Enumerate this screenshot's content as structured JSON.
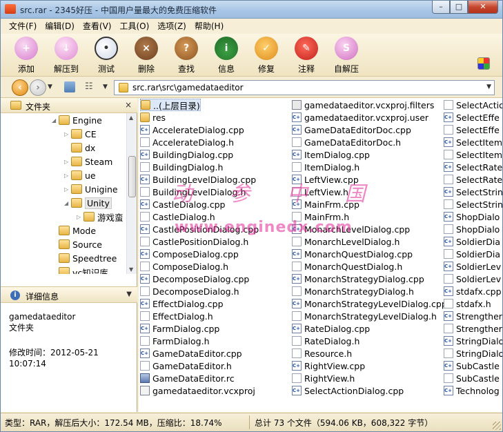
{
  "window": {
    "title": "src.rar - 2345好压 - 中国用户量最大的免费压缩软件",
    "controls": [
      "–",
      "□",
      "✕"
    ]
  },
  "menu": [
    "文件(F)",
    "编辑(D)",
    "查看(V)",
    "工具(O)",
    "选项(Z)",
    "帮助(H)"
  ],
  "toolbar": [
    {
      "label": "添加",
      "icon": "add-icon",
      "glyph": "+"
    },
    {
      "label": "解压到",
      "icon": "extract-icon",
      "glyph": "↓"
    },
    {
      "label": "测试",
      "icon": "test-icon",
      "glyph": "•"
    },
    {
      "label": "删除",
      "icon": "delete-icon",
      "glyph": "×"
    },
    {
      "label": "查找",
      "icon": "find-icon",
      "glyph": "?"
    },
    {
      "label": "信息",
      "icon": "info-icon",
      "glyph": "i"
    },
    {
      "label": "修复",
      "icon": "repair-icon",
      "glyph": "✓"
    },
    {
      "label": "注释",
      "icon": "comment-icon",
      "glyph": "✎"
    },
    {
      "label": "自解压",
      "icon": "sfx-icon",
      "glyph": "S"
    }
  ],
  "address": {
    "path": "src.rar\\src\\gamedataeditor"
  },
  "folders_panel": {
    "title": "文件夹",
    "close": "×",
    "tree": [
      {
        "label": "Engine",
        "depth": 0,
        "expander": "◢"
      },
      {
        "label": "CE",
        "depth": 1,
        "expander": "▷"
      },
      {
        "label": "dx",
        "depth": 1,
        "expander": ""
      },
      {
        "label": "Steam",
        "depth": 1,
        "expander": "▷"
      },
      {
        "label": "ue",
        "depth": 1,
        "expander": "▷"
      },
      {
        "label": "Unigine",
        "depth": 1,
        "expander": "▷"
      },
      {
        "label": "Unity",
        "depth": 1,
        "expander": "◢",
        "selected": true
      },
      {
        "label": "游戏蛮",
        "depth": 2,
        "expander": "▷"
      },
      {
        "label": "Mode",
        "depth": 0,
        "expander": ""
      },
      {
        "label": "Source",
        "depth": 0,
        "expander": ""
      },
      {
        "label": "Speedtree",
        "depth": 0,
        "expander": ""
      },
      {
        "label": "vc知识库",
        "depth": 0,
        "expander": ""
      }
    ]
  },
  "details_panel": {
    "title": "详细信息",
    "name": "gamedataeditor",
    "type": "文件夹",
    "modified": "修改时间：2012-05-21 10:07:14"
  },
  "files": {
    "col1": [
      {
        "name": "..(上层目录)",
        "type": "up",
        "selected": true
      },
      {
        "name": "res",
        "type": "folder"
      },
      {
        "name": "AccelerateDialog.cpp",
        "type": "cpp"
      },
      {
        "name": "AccelerateDialog.h",
        "type": "h"
      },
      {
        "name": "BuildingDialog.cpp",
        "type": "cpp"
      },
      {
        "name": "BuildingDialog.h",
        "type": "h"
      },
      {
        "name": "BuildingLevelDialog.cpp",
        "type": "cpp"
      },
      {
        "name": "BuildingLevelDialog.h",
        "type": "h"
      },
      {
        "name": "CastleDialog.cpp",
        "type": "cpp"
      },
      {
        "name": "CastleDialog.h",
        "type": "h"
      },
      {
        "name": "CastlePositionDialog.cpp",
        "type": "cpp"
      },
      {
        "name": "CastlePositionDialog.h",
        "type": "h"
      },
      {
        "name": "ComposeDialog.cpp",
        "type": "cpp"
      },
      {
        "name": "ComposeDialog.h",
        "type": "h"
      },
      {
        "name": "DecomposeDialog.cpp",
        "type": "cpp"
      },
      {
        "name": "DecomposeDialog.h",
        "type": "h"
      },
      {
        "name": "EffectDialog.cpp",
        "type": "cpp"
      },
      {
        "name": "EffectDialog.h",
        "type": "h"
      },
      {
        "name": "FarmDialog.cpp",
        "type": "cpp"
      },
      {
        "name": "FarmDialog.h",
        "type": "h"
      },
      {
        "name": "GameDataEditor.cpp",
        "type": "cpp"
      },
      {
        "name": "GameDataEditor.h",
        "type": "h"
      },
      {
        "name": "GameDataEditor.rc",
        "type": "rc"
      },
      {
        "name": "gamedataeditor.vcxproj",
        "type": "proj"
      }
    ],
    "col2": [
      {
        "name": "gamedataeditor.vcxproj.filters",
        "type": "filters"
      },
      {
        "name": "gamedataeditor.vcxproj.user",
        "type": "cpp"
      },
      {
        "name": "GameDataEditorDoc.cpp",
        "type": "cpp"
      },
      {
        "name": "GameDataEditorDoc.h",
        "type": "h"
      },
      {
        "name": "ItemDialog.cpp",
        "type": "cpp"
      },
      {
        "name": "ItemDialog.h",
        "type": "h"
      },
      {
        "name": "LeftView.cpp",
        "type": "cpp"
      },
      {
        "name": "LeftView.h",
        "type": "h"
      },
      {
        "name": "MainFrm.cpp",
        "type": "cpp"
      },
      {
        "name": "MainFrm.h",
        "type": "h"
      },
      {
        "name": "MonarchLevelDialog.cpp",
        "type": "cpp"
      },
      {
        "name": "MonarchLevelDialog.h",
        "type": "h"
      },
      {
        "name": "MonarchQuestDialog.cpp",
        "type": "cpp"
      },
      {
        "name": "MonarchQuestDialog.h",
        "type": "h"
      },
      {
        "name": "MonarchStrategyDialog.cpp",
        "type": "cpp"
      },
      {
        "name": "MonarchStrategyDialog.h",
        "type": "h"
      },
      {
        "name": "MonarchStrategyLevelDialog.cpp",
        "type": "cpp"
      },
      {
        "name": "MonarchStrategyLevelDialog.h",
        "type": "h"
      },
      {
        "name": "RateDialog.cpp",
        "type": "cpp"
      },
      {
        "name": "RateDialog.h",
        "type": "h"
      },
      {
        "name": "Resource.h",
        "type": "h"
      },
      {
        "name": "RightView.cpp",
        "type": "cpp"
      },
      {
        "name": "RightView.h",
        "type": "h"
      },
      {
        "name": "SelectActionDialog.cpp",
        "type": "cpp"
      }
    ],
    "col3": [
      {
        "name": "SelectActio",
        "type": "h"
      },
      {
        "name": "SelectEffe",
        "type": "cpp"
      },
      {
        "name": "SelectEffe",
        "type": "h"
      },
      {
        "name": "SelectItem",
        "type": "cpp"
      },
      {
        "name": "SelectItem",
        "type": "h"
      },
      {
        "name": "SelectRate",
        "type": "cpp"
      },
      {
        "name": "SelectRate",
        "type": "h"
      },
      {
        "name": "SelectStrin",
        "type": "cpp"
      },
      {
        "name": "SelectStrin",
        "type": "h"
      },
      {
        "name": "ShopDialo",
        "type": "cpp"
      },
      {
        "name": "ShopDialo",
        "type": "h"
      },
      {
        "name": "SoldierDia",
        "type": "cpp"
      },
      {
        "name": "SoldierDia",
        "type": "h"
      },
      {
        "name": "SoldierLev",
        "type": "cpp"
      },
      {
        "name": "SoldierLev",
        "type": "h"
      },
      {
        "name": "stdafx.cpp",
        "type": "cpp"
      },
      {
        "name": "stdafx.h",
        "type": "h"
      },
      {
        "name": "Strengther",
        "type": "cpp"
      },
      {
        "name": "Strengther",
        "type": "h"
      },
      {
        "name": "StringDialo",
        "type": "cpp"
      },
      {
        "name": "StringDialo",
        "type": "h"
      },
      {
        "name": "SubCastle",
        "type": "cpp"
      },
      {
        "name": "SubCastle",
        "type": "h"
      },
      {
        "name": "Technolog",
        "type": "cpp"
      }
    ]
  },
  "watermark": {
    "line1": "动 参 中 国",
    "line2": "www.enginedx.com"
  },
  "status": {
    "left": "类型：RAR，解压后大小：172.54 MB，压缩比：18.74%",
    "right": "总计 73 个文件（594.06 KB，608,322 字节）"
  },
  "colors": {
    "frame": "#f4ecd3",
    "selection": "#dce8f7",
    "watermark": "#e12896"
  }
}
